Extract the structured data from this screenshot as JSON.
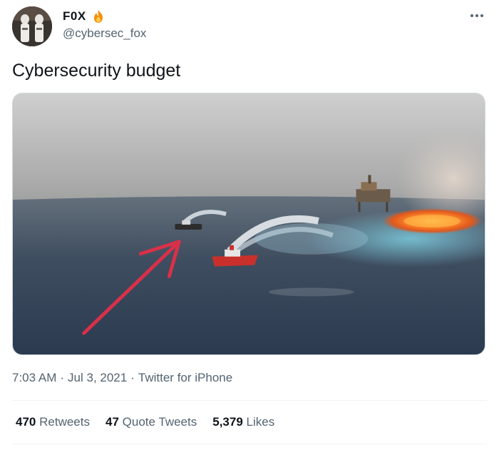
{
  "author": {
    "display_name": "F0X",
    "handle": "@cybersec_fox",
    "badge_icon": "fire-emoji-icon"
  },
  "tweet": {
    "text": "Cybersecurity budget"
  },
  "meta": {
    "time": "7:03 AM",
    "date": "Jul 3, 2021",
    "source": "Twitter for iPhone",
    "separator": "·"
  },
  "stats": {
    "retweets_count": "470",
    "retweets_label": "Retweets",
    "quotes_count": "47",
    "quotes_label": "Quote Tweets",
    "likes_count": "5,379",
    "likes_label": "Likes"
  },
  "colors": {
    "text_primary": "#0f1419",
    "text_secondary": "#536471",
    "divider": "#eff3f4",
    "arrow_red": "#d9304a"
  }
}
